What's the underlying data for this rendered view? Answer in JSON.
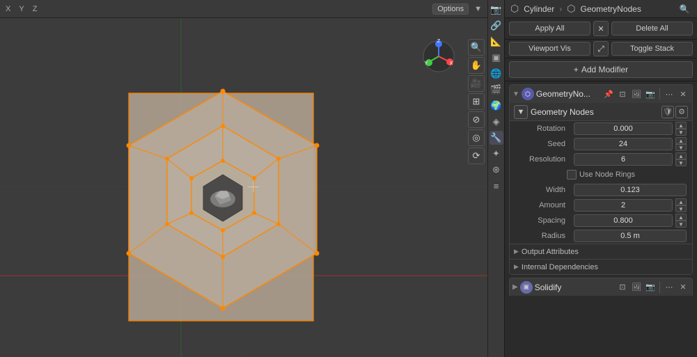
{
  "viewport": {
    "topbar": {
      "x_label": "X",
      "y_label": "Y",
      "z_label": "Z",
      "options_label": "Options",
      "toggle_label": "▼"
    }
  },
  "properties": {
    "breadcrumb": {
      "icon": "🔧",
      "cylinder": "Cylinder",
      "arrow": "›",
      "geonode_icon": "⬡",
      "geometry_nodes": "GeometryNodes"
    },
    "buttons": {
      "apply_all": "Apply All",
      "close": "✕",
      "delete_all": "Delete All",
      "viewport_vis": "Viewport Vis",
      "expand": "⤢",
      "toggle_stack": "Toggle Stack",
      "add_plus": "+",
      "add_modifier": "Add Modifier"
    },
    "geometry_nodes_modifier": {
      "header_title": "GeometryNo...",
      "sub_name": "Geometry Nodes",
      "rotation_label": "Rotation",
      "rotation_value": "0.000",
      "seed_label": "Seed",
      "seed_value": "24",
      "resolution_label": "Resolution",
      "resolution_value": "6",
      "use_node_rings": "Use Node Rings",
      "width_label": "Width",
      "width_value": "0.123",
      "amount_label": "Amount",
      "amount_value": "2",
      "spacing_label": "Spacing",
      "spacing_value": "0.800",
      "radius_label": "Radius",
      "radius_value": "0.5 m",
      "output_attributes": "Output Attributes",
      "internal_dependencies": "Internal Dependencies"
    },
    "solidify_modifier": {
      "header_title": "Solidify"
    }
  },
  "sidebar_nav": {
    "icons": [
      "📷",
      "🔗",
      "📐",
      "🌐",
      "🔧",
      "✋",
      "🎥",
      "⊞",
      "🔍",
      "⊕",
      "⊘",
      "≡"
    ]
  }
}
